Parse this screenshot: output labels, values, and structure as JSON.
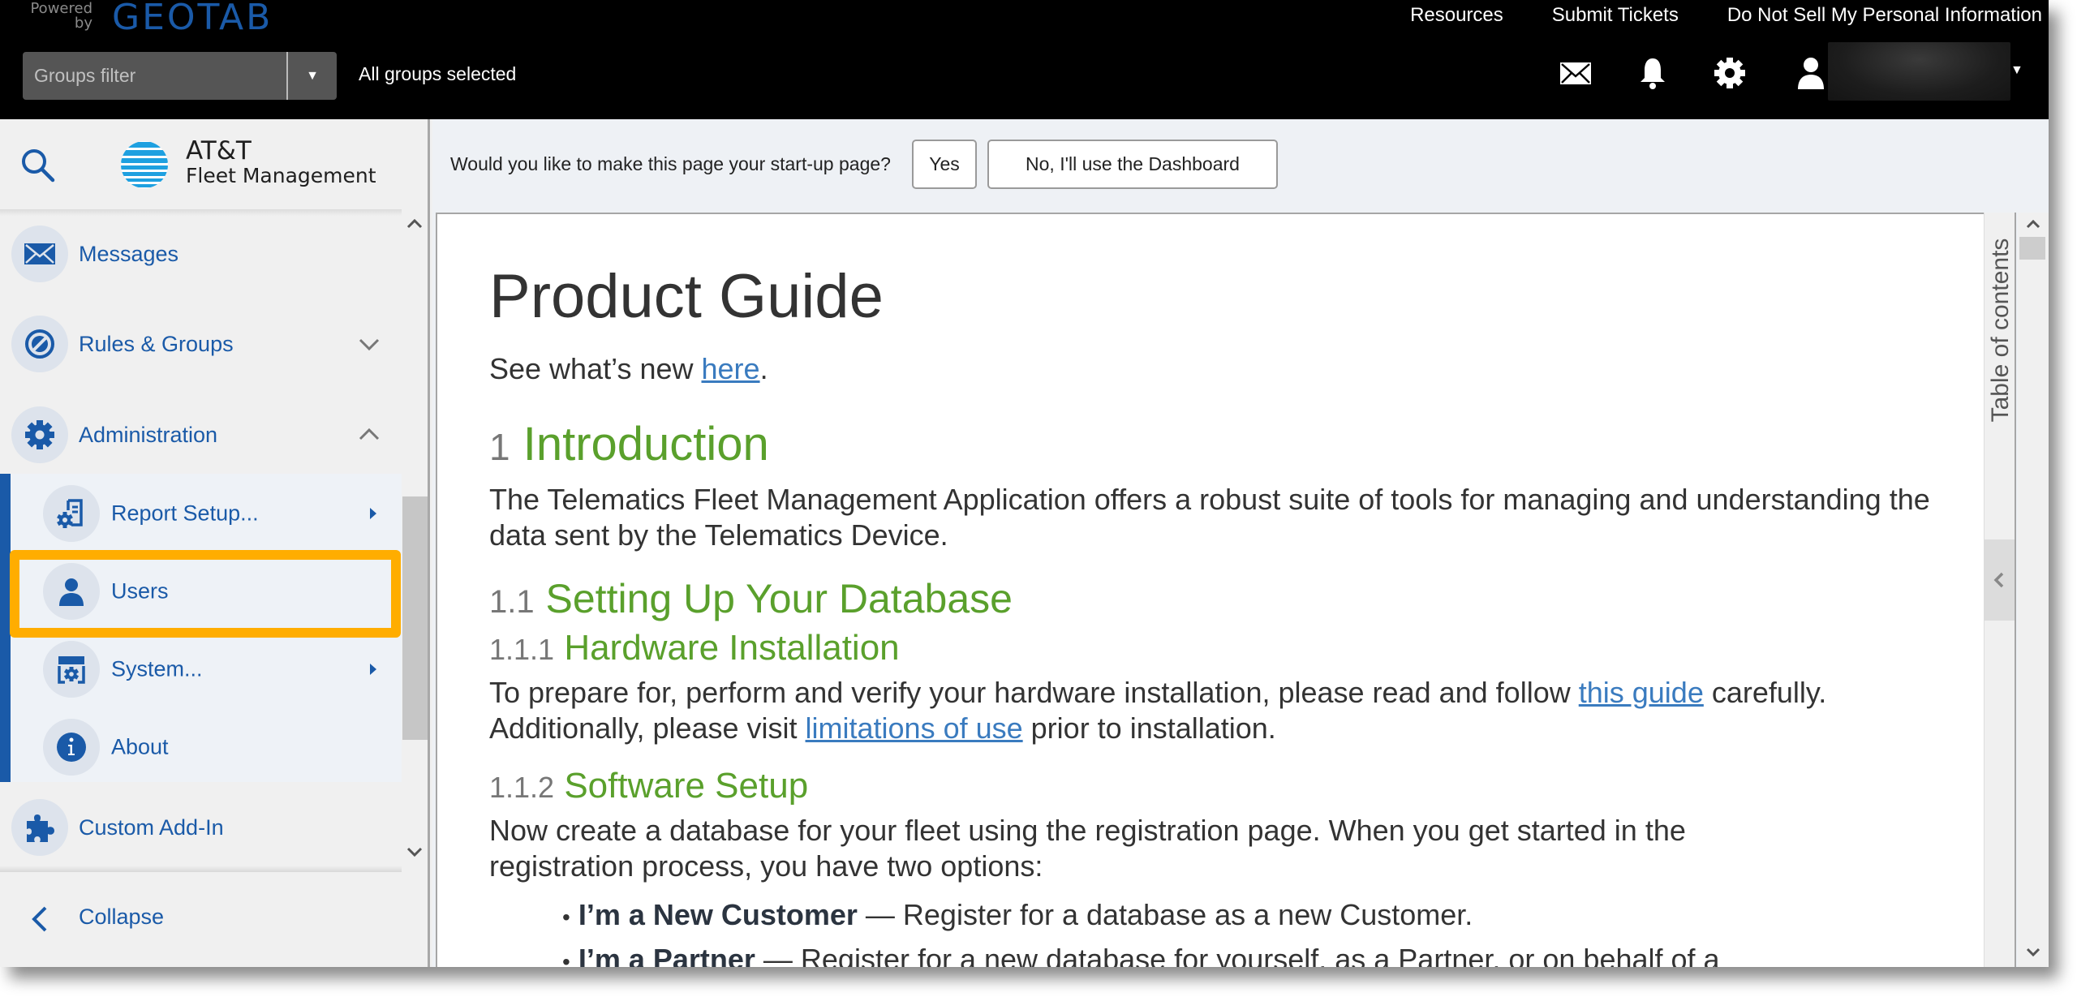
{
  "header": {
    "powered_by": "Powered\nby",
    "powered_line1": "Powered",
    "powered_line2": "by",
    "brand": "GEOTAB",
    "links": [
      "Resources",
      "Submit Tickets",
      "Do Not Sell My Personal Information"
    ],
    "groups_filter": {
      "placeholder": "Groups filter",
      "dropdown_glyph": "▼"
    },
    "groups_status": "All groups selected",
    "icons": [
      "mail-icon",
      "bell-icon",
      "gear-icon",
      "user-icon"
    ],
    "user_caret": "▼"
  },
  "sidebar": {
    "logo": {
      "title": "AT&T",
      "subtitle": "Fleet Management"
    },
    "items": [
      {
        "label": "Messages",
        "icon": "envelope-icon"
      },
      {
        "label": "Rules & Groups",
        "icon": "rules-icon",
        "state": "collapsed"
      },
      {
        "label": "Administration",
        "icon": "gear-icon",
        "state": "expanded"
      }
    ],
    "admin_subitems": [
      {
        "label": "Report Setup...",
        "icon": "report-setup-icon",
        "has_submenu": true
      },
      {
        "label": "Users",
        "icon": "user-icon",
        "highlighted": true
      },
      {
        "label": "System...",
        "icon": "system-icon",
        "has_submenu": true
      },
      {
        "label": "About",
        "icon": "info-icon"
      }
    ],
    "after_items": [
      {
        "label": "Custom Add-In",
        "icon": "puzzle-icon"
      }
    ],
    "collapse_label": "Collapse"
  },
  "startup_prompt": {
    "question": "Would you like to make this page your start-up page?",
    "yes_label": "Yes",
    "no_label": "No, I'll use the Dashboard"
  },
  "document": {
    "title": "Product Guide",
    "whats_new_prefix": "See what’s new ",
    "whats_new_link": "here",
    "whats_new_suffix": ".",
    "sections": {
      "intro": {
        "num": "1",
        "title": "Introduction",
        "body": "The Telematics Fleet Management Application offers a robust suite of tools for managing and understanding the data sent by the Telematics Device."
      },
      "setup_db": {
        "num": "1.1",
        "title": "Setting Up Your Database"
      },
      "hardware": {
        "num": "1.1.1",
        "title": "Hardware Installation",
        "body_part1": "To prepare for, perform and verify your hardware installation, please read and follow ",
        "link1": "this guide",
        "body_part2": " carefully. Additionally, please visit ",
        "link2": "limitations of use",
        "body_part3": " prior to installation."
      },
      "software": {
        "num": "1.1.2",
        "title": "Software Setup",
        "body": "Now create a database for your fleet using the registration page. When you get started in the registration process, you have two options:",
        "bullets": [
          {
            "bold": "I’m a New Customer",
            "text": " — Register for a database as a new Customer."
          },
          {
            "bold": "I’m a Partner",
            "text": " — Register for a new database for yourself, as a Partner, or on behalf of a"
          }
        ]
      }
    }
  },
  "toc": {
    "label": "Table of contents",
    "toggle_glyph": "‹"
  },
  "colors": {
    "brand_blue": "#1a5aa8",
    "heading_green": "#5aa02c",
    "highlight_orange": "#ffad00",
    "link_blue": "#3a7bbf",
    "header_black": "#000000"
  }
}
